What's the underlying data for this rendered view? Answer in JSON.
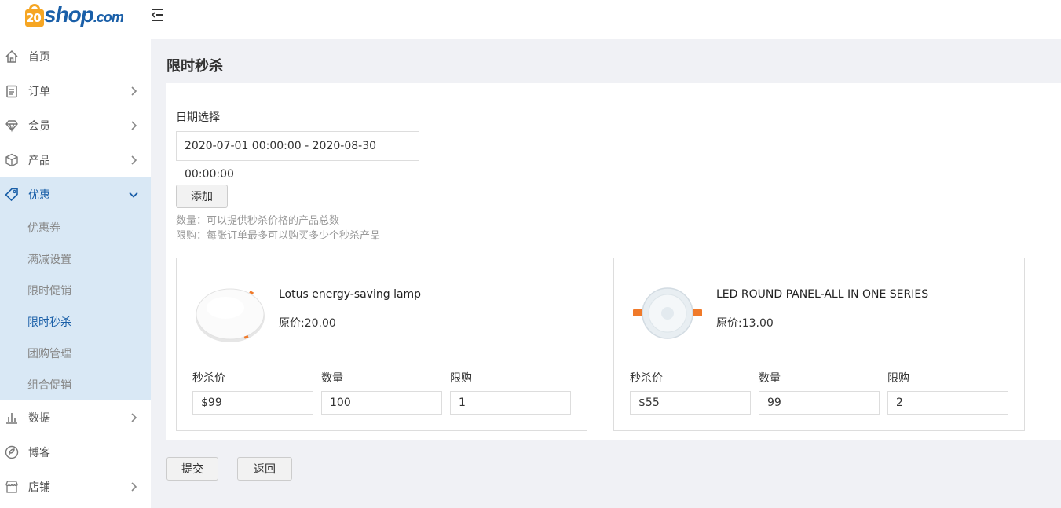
{
  "brand": {
    "prefix": "20",
    "name": "shop",
    "suffix": ".com"
  },
  "sidebar": {
    "items": [
      {
        "label": "首页",
        "icon": "home-icon",
        "chevron": false
      },
      {
        "label": "订单",
        "icon": "clipboard-icon",
        "chevron": true
      },
      {
        "label": "会员",
        "icon": "diamond-icon",
        "chevron": true
      },
      {
        "label": "产品",
        "icon": "box-icon",
        "chevron": true
      },
      {
        "label": "优惠",
        "icon": "tag-icon",
        "chevron": true,
        "expanded": true
      }
    ],
    "sub_items": [
      "优惠券",
      "满减设置",
      "限时促销",
      "限时秒杀",
      "团购管理",
      "组合促销"
    ],
    "current_sub": "限时秒杀",
    "items_after": [
      {
        "label": "数据",
        "icon": "bar-chart-icon",
        "chevron": true
      },
      {
        "label": "博客",
        "icon": "blog-icon",
        "chevron": false
      },
      {
        "label": "店铺",
        "icon": "store-icon",
        "chevron": true
      }
    ]
  },
  "page": {
    "title": "限时秒杀",
    "date_label": "日期选择",
    "date_range": "2020-07-01 00:00:00 - 2020-08-30 00:00:00",
    "add_button": "添加",
    "hint_quantity": "数量：可以提供秒杀价格的产品总数",
    "hint_limit": "限购：每张订单最多可以购买多少个秒杀产品",
    "field_labels": {
      "price": "秒杀价",
      "quantity": "数量",
      "limit": "限购"
    },
    "products": [
      {
        "name": "Lotus energy-saving lamp",
        "original_price": "原价:20.00",
        "flash_price": "$99",
        "quantity": "100",
        "limit": "1"
      },
      {
        "name": "LED ROUND PANEL-ALL IN ONE SERIES",
        "original_price": "原价:13.00",
        "flash_price": "$55",
        "quantity": "99",
        "limit": "2"
      }
    ],
    "submit_button": "提交",
    "back_button": "返回"
  },
  "colors": {
    "accent": "#1a5fa8",
    "active_bg": "#d9e8f5",
    "logo_orange": "#f6a623",
    "main_bg": "#f0f1f5"
  }
}
